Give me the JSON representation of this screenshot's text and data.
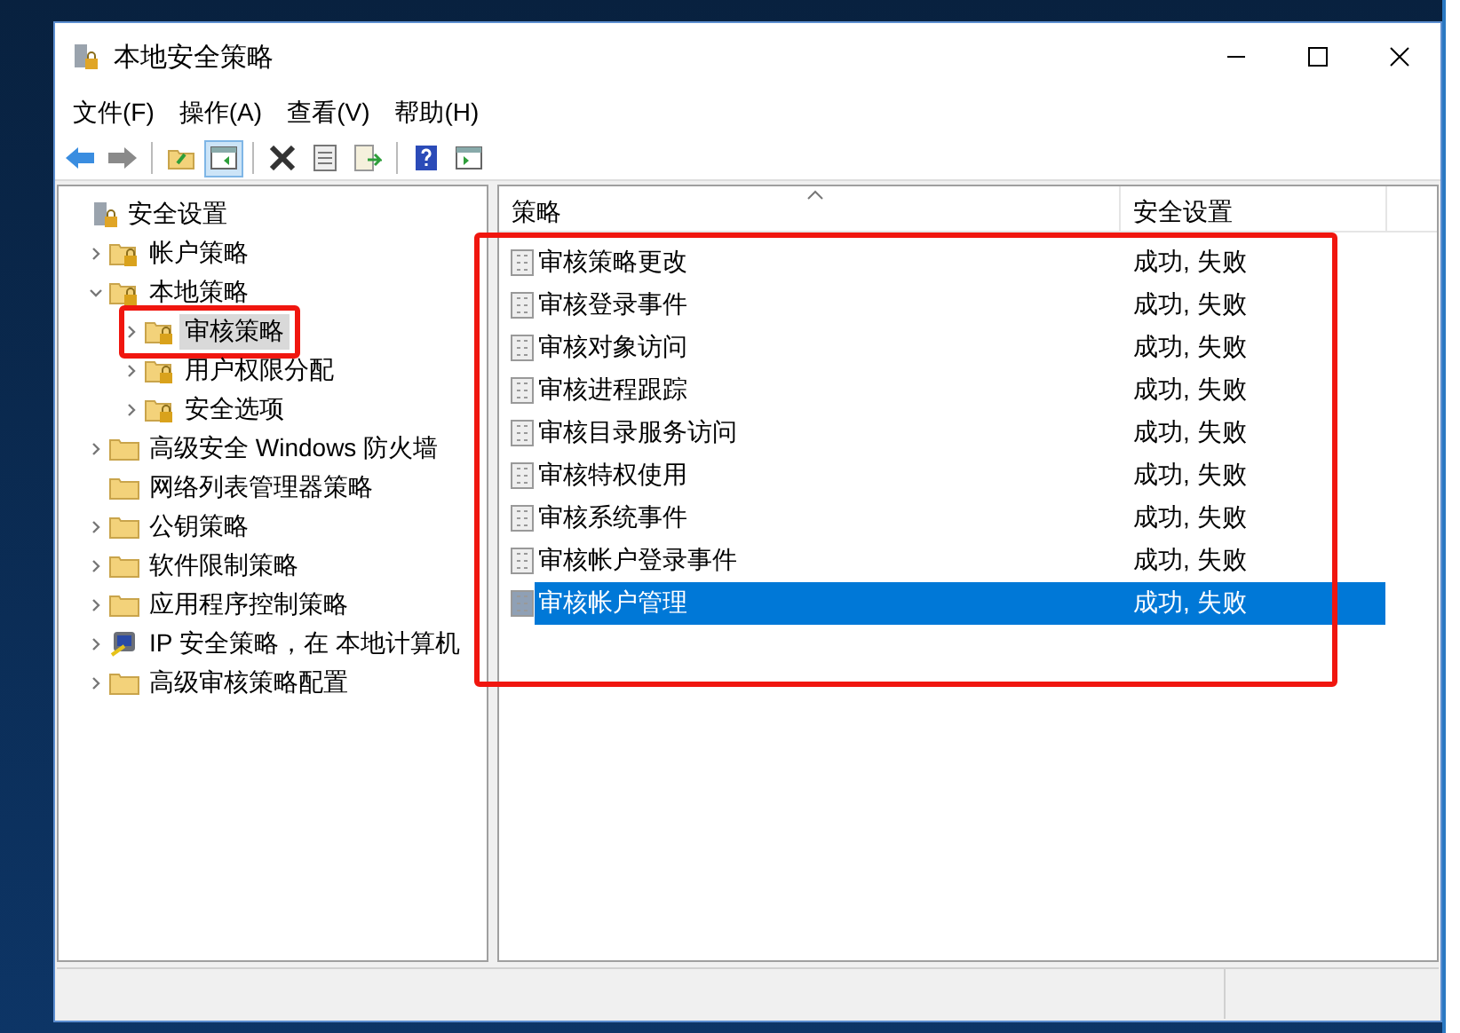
{
  "window": {
    "title": "本地安全策略"
  },
  "menu": [
    "文件(F)",
    "操作(A)",
    "查看(V)",
    "帮助(H)"
  ],
  "toolbar": [
    [
      {
        "kind": "back",
        "pressed": false
      },
      {
        "kind": "forward",
        "pressed": false
      }
    ],
    [
      {
        "kind": "up",
        "pressed": false
      },
      {
        "kind": "tree",
        "pressed": true
      }
    ],
    [
      {
        "kind": "delete",
        "pressed": false
      },
      {
        "kind": "properties",
        "pressed": false
      },
      {
        "kind": "export",
        "pressed": false
      }
    ],
    [
      {
        "kind": "help",
        "pressed": false
      },
      {
        "kind": "pane",
        "pressed": false
      }
    ]
  ],
  "tree": [
    {
      "label": "安全设置",
      "kind": "server",
      "selected": false,
      "highlighted": false,
      "children": [
        {
          "label": "帐户策略",
          "kind": "locked-folder",
          "expanded": false,
          "selected": false,
          "highlighted": false
        },
        {
          "label": "本地策略",
          "kind": "locked-folder",
          "expanded": true,
          "selected": false,
          "highlighted": false,
          "children": [
            {
              "label": "审核策略",
              "kind": "locked-folder",
              "expanded": false,
              "selected": true,
              "highlighted": true
            },
            {
              "label": "用户权限分配",
              "kind": "locked-folder",
              "expanded": false,
              "selected": false,
              "highlighted": false
            },
            {
              "label": "安全选项",
              "kind": "locked-folder",
              "expanded": false,
              "selected": false,
              "highlighted": false
            }
          ]
        },
        {
          "label": "高级安全 Windows 防火墙",
          "kind": "folder",
          "expanded": false,
          "selected": false,
          "highlighted": false
        },
        {
          "label": "网络列表管理器策略",
          "kind": "folder",
          "selected": false,
          "highlighted": false
        },
        {
          "label": "公钥策略",
          "kind": "folder",
          "expanded": false,
          "selected": false,
          "highlighted": false
        },
        {
          "label": "软件限制策略",
          "kind": "folder",
          "expanded": false,
          "selected": false,
          "highlighted": false
        },
        {
          "label": "应用程序控制策略",
          "kind": "folder",
          "expanded": false,
          "selected": false,
          "highlighted": false
        },
        {
          "label": "IP 安全策略，在 本地计算机",
          "kind": "network",
          "expanded": false,
          "selected": false,
          "highlighted": false
        },
        {
          "label": "高级审核策略配置",
          "kind": "folder",
          "expanded": false,
          "selected": false,
          "highlighted": false
        }
      ]
    }
  ],
  "table": {
    "columns": [
      "策略",
      "安全设置"
    ],
    "highlighted": true,
    "rows": [
      {
        "policy": "审核策略更改",
        "setting": "成功, 失败",
        "selected": false
      },
      {
        "policy": "审核登录事件",
        "setting": "成功, 失败",
        "selected": false
      },
      {
        "policy": "审核对象访问",
        "setting": "成功, 失败",
        "selected": false
      },
      {
        "policy": "审核进程跟踪",
        "setting": "成功, 失败",
        "selected": false
      },
      {
        "policy": "审核目录服务访问",
        "setting": "成功, 失败",
        "selected": false
      },
      {
        "policy": "审核特权使用",
        "setting": "成功, 失败",
        "selected": false
      },
      {
        "policy": "审核系统事件",
        "setting": "成功, 失败",
        "selected": false
      },
      {
        "policy": "审核帐户登录事件",
        "setting": "成功, 失败",
        "selected": false
      },
      {
        "policy": "审核帐户管理",
        "setting": "成功, 失败",
        "selected": true
      }
    ]
  }
}
